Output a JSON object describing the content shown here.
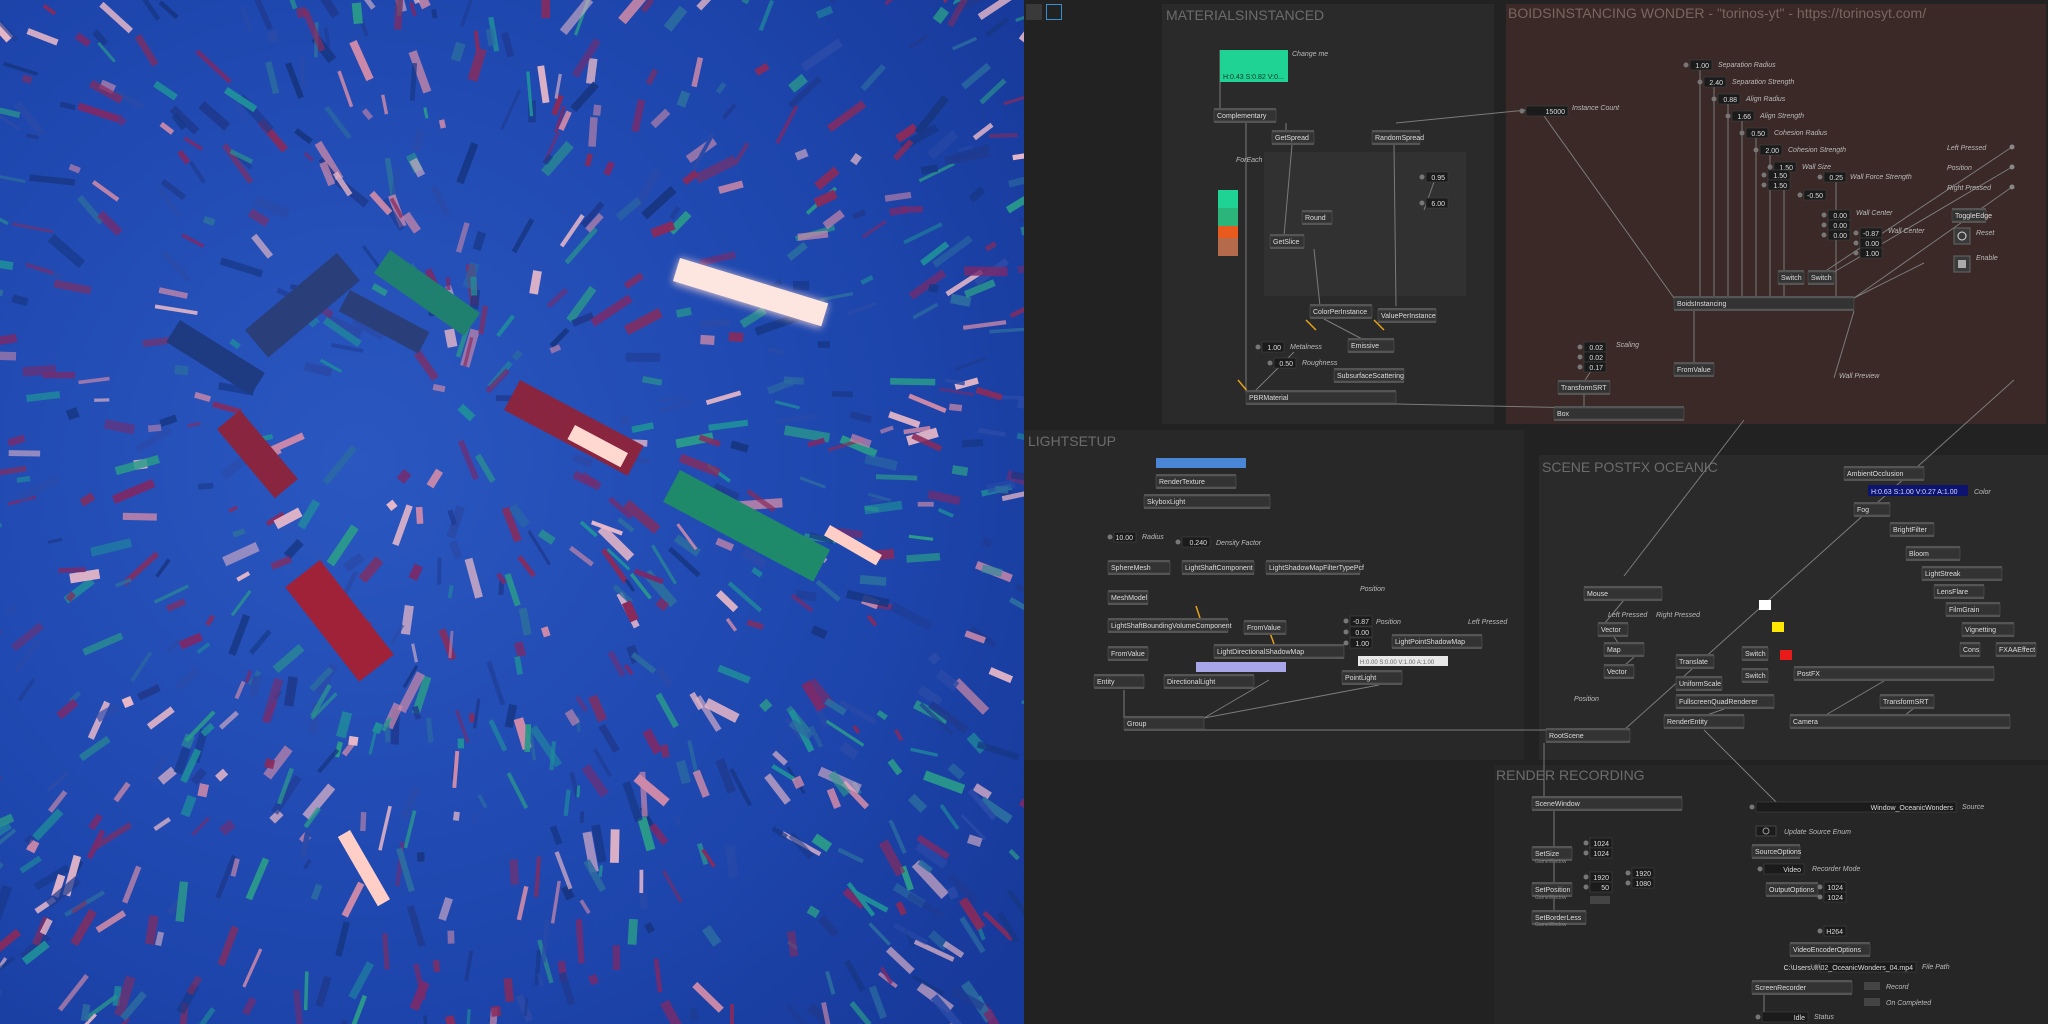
{
  "window": {
    "toolbar_icons": [
      "square-icon",
      "square-outline-icon"
    ]
  },
  "regions": {
    "materials": "MATERIALSINSTANCED",
    "boids": "BOIDSINSTANCING WONDER - \"torinos-yt\" - https://torinosyt.com/",
    "lights": "LIGHTSETUP",
    "postfx": "SCENE POSTFX OCEANIC",
    "render": "RENDER RECORDING"
  },
  "materials": {
    "color_label": "Change me",
    "color_value": "H:0.43 S:0.82 V:0...",
    "nodes": [
      "Complementary",
      "ForEach",
      "GetSpread",
      "RandomSpread",
      "Round",
      "GetSlice",
      "ColorPerInstance",
      "ValuePerInstance",
      "Emissive",
      "SubsurfaceScattering",
      "PBRMaterial"
    ],
    "values": {
      "v1": "0.95",
      "v2": "6.00",
      "metalness": "1.00",
      "roughness": "0.50"
    },
    "labels": {
      "metalness": "Metalness",
      "roughness": "Roughness"
    }
  },
  "boids": {
    "instance_count_label": "Instance Count",
    "instance_count": "15000",
    "params": [
      {
        "value": "1.00",
        "label": "Separation Radius"
      },
      {
        "value": "2.40",
        "label": "Separation Strength"
      },
      {
        "value": "0.88",
        "label": "Align Radius"
      },
      {
        "value": "1.66",
        "label": "Align Strength"
      },
      {
        "value": "0.50",
        "label": "Cohesion Radius"
      },
      {
        "value": "2.00",
        "label": "Cohesion Strength"
      },
      {
        "value": "1.50",
        "label": "Wall Size"
      }
    ],
    "wall_size_extra": [
      "1.50",
      "1.50"
    ],
    "wall_force": {
      "value": "0.25",
      "label": "Wall Force Strength"
    },
    "neg": "-0.50",
    "wall_center": {
      "values": [
        "0.00",
        "0.00",
        "0.00"
      ],
      "label": "Wall Center"
    },
    "wall_center2": {
      "values": [
        "-0.87",
        "0.00",
        "1.00"
      ],
      "label": "Wall Center"
    },
    "inputs": [
      "Left Pressed",
      "Position",
      "Right Pressed"
    ],
    "nodes": [
      "ToggleEdge",
      "Switch",
      "Switch",
      "BoidsInstancing",
      "TransformSRT",
      "FromValue",
      "Box"
    ],
    "reset_label": "Reset",
    "enable_label": "Enable",
    "scaling": {
      "values": [
        "0.02",
        "0.02",
        "0.17"
      ],
      "label": "Scaling"
    },
    "wall_preview": "Wall Preview"
  },
  "lights": {
    "nodes": [
      "RenderTexture",
      "SkyboxLight",
      "SphereMesh",
      "LightShaftComponent",
      "LightShadowMapFilterTypePcf",
      "MeshModel",
      "LightShaftBoundingVolumeComponent",
      "FromValue",
      "FromValue",
      "LightDirectionalShadowMap",
      "LightPointShadowMap",
      "Entity",
      "DirectionalLight",
      "PointLight",
      "Group"
    ],
    "radius": {
      "value": "10.00",
      "label": "Radius"
    },
    "density": {
      "value": "0.240",
      "label": "Density Factor"
    },
    "position_label": "Position",
    "position2": {
      "values": [
        "-0.87",
        "0.00",
        "1.00"
      ],
      "label": "Position"
    },
    "left_pressed": "Left Pressed",
    "color_readout": "H:0.00 S:0.00 V:1.00 A:1.00"
  },
  "postfx": {
    "nodes": [
      "AmbientOcclusion",
      "Fog",
      "BrightFilter",
      "Bloom",
      "LightStreak",
      "LensFlare",
      "FilmGrain",
      "Vignetting",
      "Cons",
      "FXAAEffect",
      "PostFX",
      "Camera",
      "TransformSRT",
      "Mouse",
      "Vector",
      "Map",
      "Vector",
      "Translate",
      "UniformScale",
      "FullscreenQuadRenderer",
      "RenderEntity",
      "Switch",
      "Switch",
      "RootScene"
    ],
    "color": {
      "value": "H:0.63 S:1.00 V:0.27 A:1.00",
      "label": "Color"
    },
    "left_pressed": "Left Pressed",
    "right_pressed": "Right Pressed",
    "position": "Position"
  },
  "render": {
    "nodes": [
      "SceneWindow",
      "SetSize",
      "SetPosition",
      "SetBorderLess",
      "SourceOptions",
      "OutputOptions",
      "VideoEncoderOptions",
      "ScreenRecorder"
    ],
    "sub": [
      "GameWindow",
      "GameWindow",
      "GameWindow"
    ],
    "size": [
      "1024",
      "1024"
    ],
    "pos": [
      "1920",
      "50"
    ],
    "pos2": [
      "1920",
      "1080"
    ],
    "source": {
      "value": "Window_OceanicWonders",
      "label": "Source"
    },
    "update_label": "Update Source Enum",
    "mode": {
      "value": "Video",
      "label": "Recorder Mode"
    },
    "out_size": [
      "1024",
      "1024"
    ],
    "codec": "H264",
    "file": {
      "value": "C:\\Users\\...\\02_OceanicWonders_04.mp4",
      "label": "File Path"
    },
    "record": "Record",
    "on_completed": "On Completed",
    "status": {
      "value": "Idle",
      "label": "Status"
    }
  }
}
